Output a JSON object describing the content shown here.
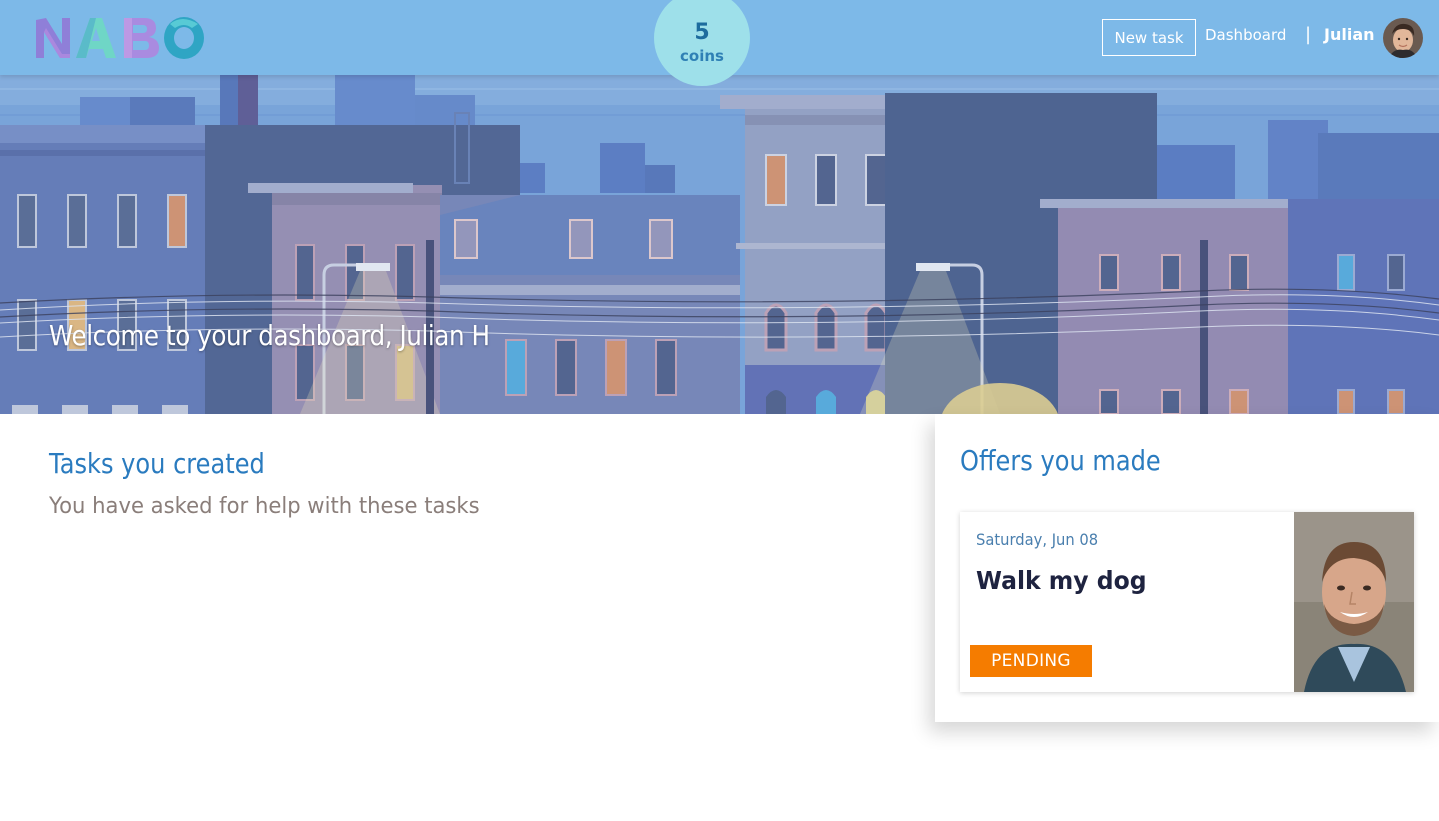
{
  "header": {
    "logo_text": "NABO",
    "coins": {
      "count": "5",
      "label": "coins"
    },
    "new_task_label": "New task",
    "dashboard_label": "Dashboard",
    "separator": "|",
    "user_name": "Julian"
  },
  "hero": {
    "welcome": "Welcome to your dashboard, Julian H"
  },
  "tasks_created": {
    "title": "Tasks you created",
    "subtitle": "You have asked for help with these tasks"
  },
  "offers": {
    "title": "Offers you made",
    "items": [
      {
        "date": "Saturday, Jun 08",
        "task": "Walk my dog",
        "status": "PENDING"
      }
    ]
  },
  "colors": {
    "header_bg": "#7db9e8",
    "coins_bg": "#9ee0ea",
    "accent_blue": "#2a7bbf",
    "status_pending": "#f57c00"
  }
}
